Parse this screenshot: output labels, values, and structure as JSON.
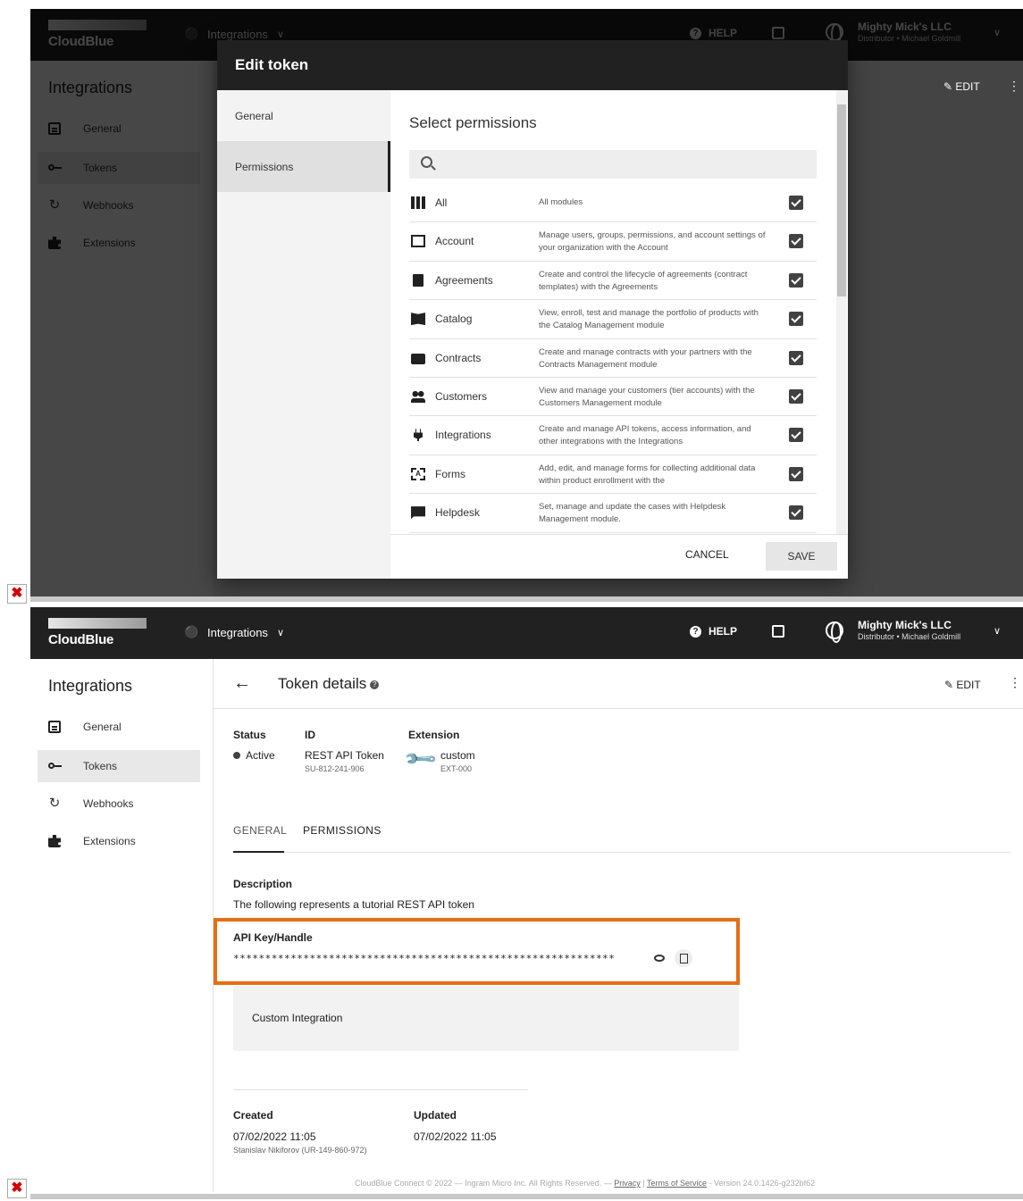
{
  "topbar": {
    "logo": "CloudBlue",
    "module": "Integrations",
    "help": "HELP",
    "account_name": "Mighty Mick's LLC",
    "account_sub": "Distributor • Michael Goldmill"
  },
  "sidebar": {
    "title": "Integrations",
    "items": [
      {
        "label": "General",
        "icon": "clipboard-icon"
      },
      {
        "label": "Tokens",
        "icon": "key-icon"
      },
      {
        "label": "Webhooks",
        "icon": "sync-icon"
      },
      {
        "label": "Extensions",
        "icon": "puzzle-icon"
      }
    ]
  },
  "dialog": {
    "title": "Edit token",
    "nav": [
      "General",
      "Permissions"
    ],
    "heading": "Select permissions",
    "permissions": [
      {
        "name": "All",
        "desc": "All modules",
        "checked": true
      },
      {
        "name": "Account",
        "desc": "Manage users, groups, permissions, and account settings of your organization with the Account",
        "checked": true
      },
      {
        "name": "Agreements",
        "desc": "Create and control the lifecycle of agreements (contract templates) with the Agreements",
        "checked": true
      },
      {
        "name": "Catalog",
        "desc": "View, enroll, test and manage the portfolio of products with the Catalog Management module",
        "checked": true
      },
      {
        "name": "Contracts",
        "desc": "Create and manage contracts with your partners with the Contracts Management module",
        "checked": true
      },
      {
        "name": "Customers",
        "desc": "View and manage your customers (tier accounts) with the Customers Management module",
        "checked": true
      },
      {
        "name": "Integrations",
        "desc": "Create and manage API tokens, access information, and other integrations with the Integrations",
        "checked": true
      },
      {
        "name": "Forms",
        "desc": "Add, edit, and manage forms for collecting additional data within product enrollment with the",
        "checked": true
      },
      {
        "name": "Helpdesk",
        "desc": "Set, manage and update the cases with Helpdesk Management module.",
        "checked": true
      }
    ],
    "cancel": "CANCEL",
    "save": "SAVE"
  },
  "ghost": {
    "edit": "EDIT"
  },
  "details": {
    "title": "Token details",
    "edit": "EDIT",
    "status_label": "Status",
    "status_value": "Active",
    "id_label": "ID",
    "id_name": "REST API Token",
    "id_value": "SU-812-241-906",
    "ext_label": "Extension",
    "ext_name": "custom",
    "ext_id": "EXT-000",
    "tabs": [
      "GENERAL",
      "PERMISSIONS"
    ],
    "desc_label": "Description",
    "desc_value": "The following represents a tutorial REST API token",
    "key_label": "API Key/Handle",
    "key_value": "************************************************************",
    "custom": "Custom Integration",
    "created_label": "Created",
    "created_value": "07/02/2022 11:05",
    "created_by": "Stanislav Nikiforov (UR-149-860-972)",
    "updated_label": "Updated",
    "updated_value": "07/02/2022 11:05"
  },
  "footer": {
    "text": "CloudBlue Connect © 2022 — Ingram Micro Inc. All Rights Reserved. —",
    "privacy": "Privacy",
    "sep": "|",
    "terms": "Terms of Service",
    "version": "- Version 24.0.1426-g232bf62"
  },
  "colors": {
    "topbar": "#212121",
    "highlight": "#e66e14"
  }
}
